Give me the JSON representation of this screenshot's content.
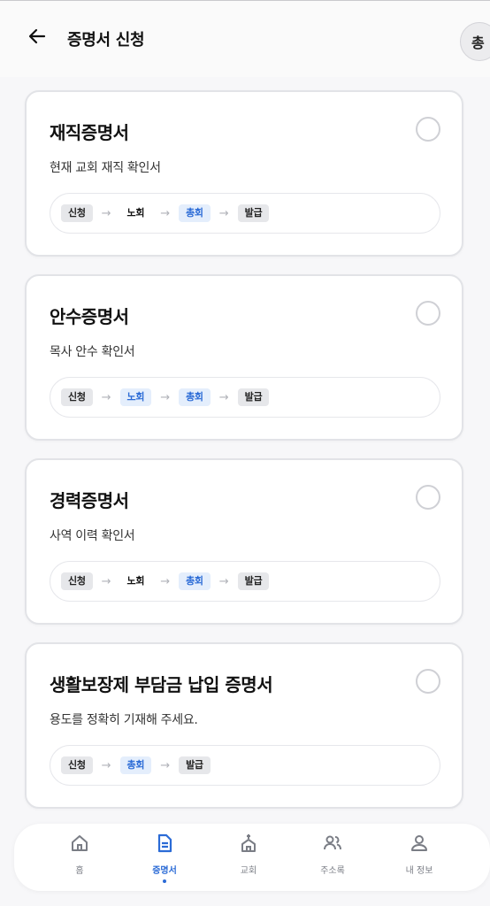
{
  "header": {
    "title": "증명서 신청",
    "back_icon": "arrow-left-icon",
    "avatar_text": "총"
  },
  "certificates": [
    {
      "title": "재직증명서",
      "description": "현재 교회 재직 확인서",
      "steps": [
        {
          "label": "신청",
          "style": "gray"
        },
        {
          "label": "노회",
          "style": "plain"
        },
        {
          "label": "총회",
          "style": "blue"
        },
        {
          "label": "발급",
          "style": "gray"
        }
      ]
    },
    {
      "title": "안수증명서",
      "description": "목사 안수 확인서",
      "steps": [
        {
          "label": "신청",
          "style": "gray"
        },
        {
          "label": "노회",
          "style": "blue"
        },
        {
          "label": "총회",
          "style": "blue"
        },
        {
          "label": "발급",
          "style": "gray"
        }
      ]
    },
    {
      "title": "경력증명서",
      "description": "사역 이력 확인서",
      "steps": [
        {
          "label": "신청",
          "style": "gray"
        },
        {
          "label": "노회",
          "style": "plain"
        },
        {
          "label": "총회",
          "style": "blue"
        },
        {
          "label": "발급",
          "style": "gray"
        }
      ]
    },
    {
      "title": "생활보장제 부담금 납입 증명서",
      "description": "용도를 정확히 기재해 주세요.",
      "steps": [
        {
          "label": "신청",
          "style": "gray"
        },
        {
          "label": "총회",
          "style": "blue"
        },
        {
          "label": "발급",
          "style": "gray"
        }
      ]
    }
  ],
  "flow_arrow": "→",
  "bottom_nav": {
    "items": [
      {
        "label": "홈",
        "icon": "home-icon"
      },
      {
        "label": "증명서",
        "icon": "document-icon",
        "active": true
      },
      {
        "label": "교회",
        "icon": "church-icon"
      },
      {
        "label": "주소록",
        "icon": "contacts-icon"
      },
      {
        "label": "내 정보",
        "icon": "profile-icon"
      }
    ]
  },
  "colors": {
    "accent": "#2b6bd6",
    "accent_bg": "#e4eefc",
    "step_gray_bg": "#e6e7ea",
    "page_bg": "#f7f7f9",
    "card_border": "#e2e3e7",
    "nav_inactive": "#7a7d85"
  }
}
